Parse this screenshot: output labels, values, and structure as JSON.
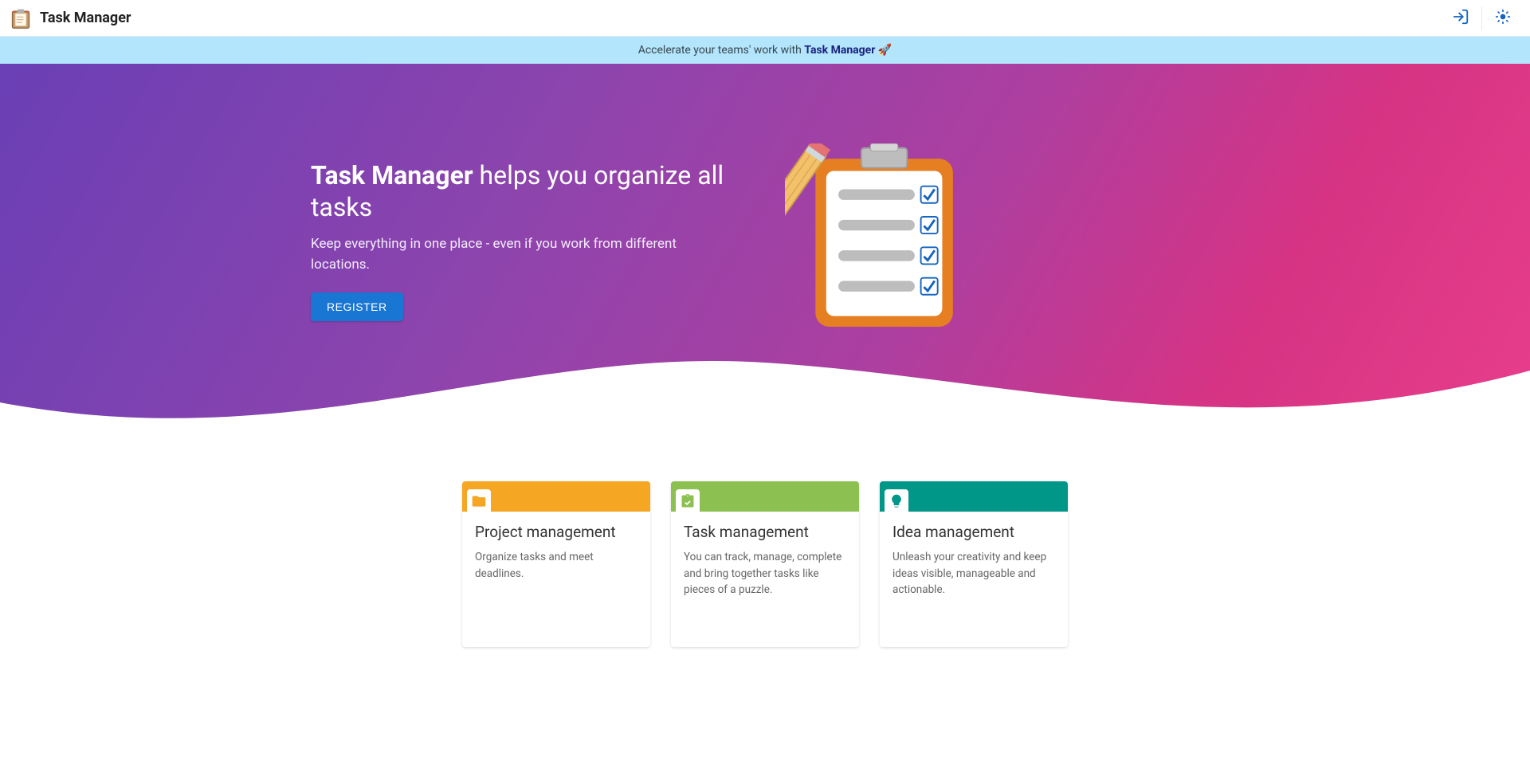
{
  "header": {
    "app_title": "Task Manager",
    "icons": {
      "login": "login-icon",
      "theme": "sun-icon"
    }
  },
  "promo": {
    "prefix": "Accelerate your teams' work with ",
    "brand": "Task Manager",
    "emoji": "🚀"
  },
  "hero": {
    "title_strong": "Task Manager",
    "title_rest": " helps you organize all tasks",
    "subtitle": "Keep everything in one place - even if you work from different locations.",
    "cta_label": "REGISTER"
  },
  "features": [
    {
      "variant": "orange",
      "icon": "folder-icon",
      "title": "Project management",
      "desc": "Organize tasks and meet deadlines."
    },
    {
      "variant": "green",
      "icon": "clipboard-icon",
      "title": "Task management",
      "desc": "You can track, manage, complete and bring together tasks like pieces of a puzzle."
    },
    {
      "variant": "teal",
      "icon": "lightbulb-icon",
      "title": "Idea management",
      "desc": "Unleash your creativity and keep ideas visible, manageable and actionable."
    }
  ],
  "colors": {
    "primary_button": "#1976d2",
    "promo_bg": "#b3e5fc",
    "card_orange": "#f5a623",
    "card_green": "#8cc152",
    "card_teal": "#009688"
  }
}
